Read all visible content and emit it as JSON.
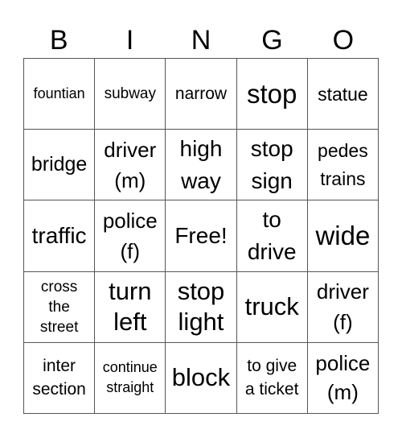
{
  "header": {
    "letters": [
      "B",
      "I",
      "N",
      "G",
      "O"
    ]
  },
  "cells": [
    "fountian",
    "subway",
    "narrow",
    "stop",
    "statue",
    "bridge",
    "driver\n(m)",
    "high\nway",
    "stop\nsign",
    "pedes\ntrains",
    "traffic",
    "police\n(f)",
    "Free!",
    "to\ndrive",
    "wide",
    "cross\nthe\nstreet",
    "turn\nleft",
    "stop\nlight",
    "truck",
    "driver\n(f)",
    "inter\nsection",
    "continue\nstraight",
    "block",
    "to give\na ticket",
    "police\n(m)"
  ]
}
